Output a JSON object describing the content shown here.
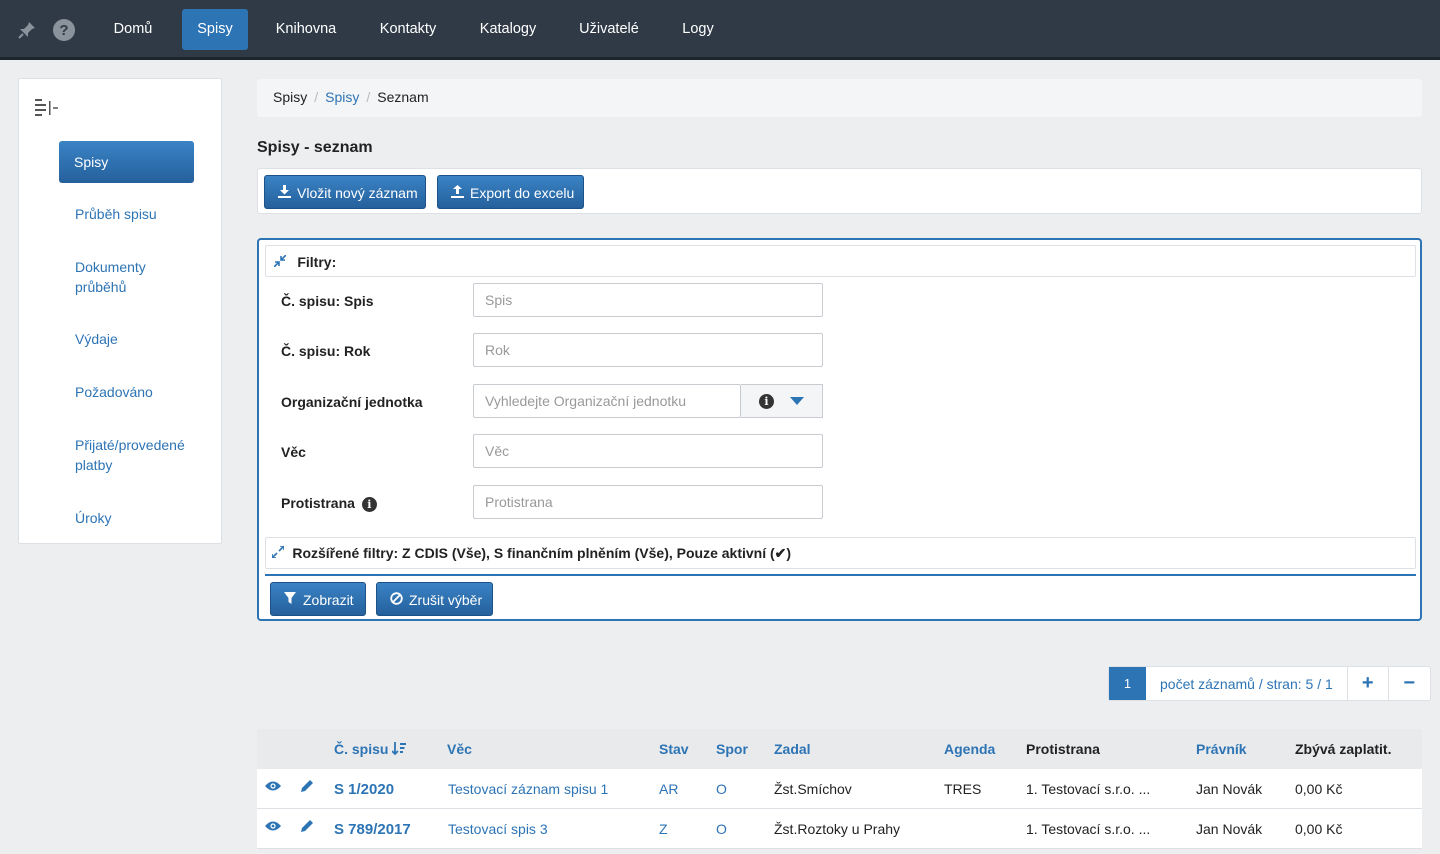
{
  "nav": {
    "items": [
      {
        "label": "Domů"
      },
      {
        "label": "Spisy"
      },
      {
        "label": "Knihovna"
      },
      {
        "label": "Kontakty"
      },
      {
        "label": "Katalogy"
      },
      {
        "label": "Uživatelé"
      },
      {
        "label": "Logy"
      }
    ],
    "active": "Spisy",
    "help_glyph": "?"
  },
  "sidebar": {
    "items": [
      {
        "label": "Spisy"
      },
      {
        "label": "Průběh spisu"
      },
      {
        "label": "Dokumenty průběhů"
      },
      {
        "label": "Výdaje"
      },
      {
        "label": "Požadováno"
      },
      {
        "label": "Přijaté/provedené platby"
      },
      {
        "label": "Úroky"
      }
    ]
  },
  "breadcrumb": [
    "Spisy",
    "Spisy",
    "Seznam"
  ],
  "page_title": "Spisy - seznam",
  "toolbar": {
    "new_record": "Vložit nový záznam",
    "export": "Export do excelu"
  },
  "filters": {
    "title": "Filtry:",
    "fields": [
      {
        "label": "Č. spisu: Spis",
        "placeholder": "Spis"
      },
      {
        "label": "Č. spisu: Rok",
        "placeholder": "Rok"
      },
      {
        "label": "Organizační jednotka",
        "placeholder": "Vyhledejte Organizační jednotku"
      },
      {
        "label": "Věc",
        "placeholder": "Věc"
      },
      {
        "label": "Protistrana",
        "placeholder": "Protistrana"
      }
    ],
    "info_glyph": "i",
    "extended": "Rozšířené filtry: Z CDIS (Vše), S finančním plněním (Vše), Pouze aktivní (✔)",
    "show_button": "Zobrazit",
    "cancel_button": "Zrušit výběr"
  },
  "pager": {
    "page": "1",
    "info": "počet záznamů / stran: 5 / 1",
    "plus": "+",
    "minus": "−"
  },
  "table": {
    "headers": [
      "Č. spisu",
      "Věc",
      "Stav",
      "Spor",
      "Zadal",
      "Agenda",
      "Protistrana",
      "Právník",
      "Zbývá zaplatit."
    ],
    "rows": [
      {
        "cislo": "S 1/2020",
        "vec": "Testovací záznam spisu 1",
        "stav": "AR",
        "spor": "O",
        "zadal": "Žst.Smíchov",
        "agenda": "TRES",
        "protistrana": "1. Testovací s.r.o. ...",
        "pravnik": "Jan Novák",
        "zbyva": "0,00 Kč"
      },
      {
        "cislo": "S 789/2017",
        "vec": "Testovací spis 3",
        "stav": "Z",
        "spor": "O",
        "zadal": "Žst.Roztoky u Prahy",
        "agenda": "",
        "protistrana": "1. Testovací s.r.o. ...",
        "pravnik": "Jan Novák",
        "zbyva": "0,00 Kč"
      }
    ]
  },
  "colors": {
    "accent": "#2d74b5",
    "topbar": "#2f3a46"
  },
  "icons": [
    "pin-icon",
    "help-icon",
    "collapse-icon",
    "download-icon",
    "export-icon",
    "filter-collapse-icon",
    "info-icon",
    "caret-down-icon",
    "expand-icon",
    "filter-icon",
    "ban-icon",
    "sort-icon",
    "eye-icon",
    "pencil-icon"
  ]
}
